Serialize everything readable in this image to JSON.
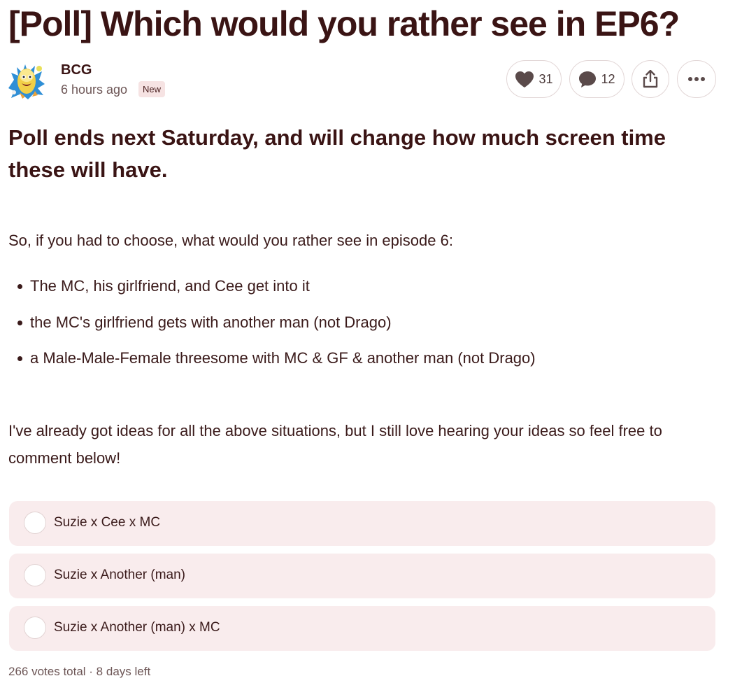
{
  "post": {
    "title": "[Poll] Which would you rather see in EP6?",
    "author": {
      "name": "BCG",
      "timestamp": "6 hours ago",
      "badge": "New"
    },
    "actions": {
      "likes": "31",
      "comments": "12",
      "like_icon": "heart-icon",
      "comment_icon": "speech-bubble-icon",
      "share_icon": "share-icon",
      "more_icon": "ellipsis-icon"
    },
    "subheading": "Poll ends next Saturday, and will change how much screen time these will have.",
    "intro": "So, if you had to choose, what would you rather see in episode 6:",
    "bullets": [
      "The MC, his girlfriend, and Cee get into it",
      "the MC's girlfriend gets with another man (not Drago)",
      "a Male-Male-Female threesome with MC & GF & another man (not Drago)"
    ],
    "closing": "I've already got ideas for all the above situations, but I still love hearing your ideas so feel free to comment below!"
  },
  "poll": {
    "options": [
      "Suzie x Cee x MC",
      "Suzie x Another (man)",
      "Suzie x Another (man) x MC"
    ],
    "footer": "266 votes total · 8 days left"
  },
  "colors": {
    "title": "#3a1414",
    "text": "#3a1a1a",
    "muted": "#6d5656",
    "badge_bg": "#f6e3e3",
    "option_bg": "#f9eced",
    "button_border": "#e2d6d6"
  }
}
